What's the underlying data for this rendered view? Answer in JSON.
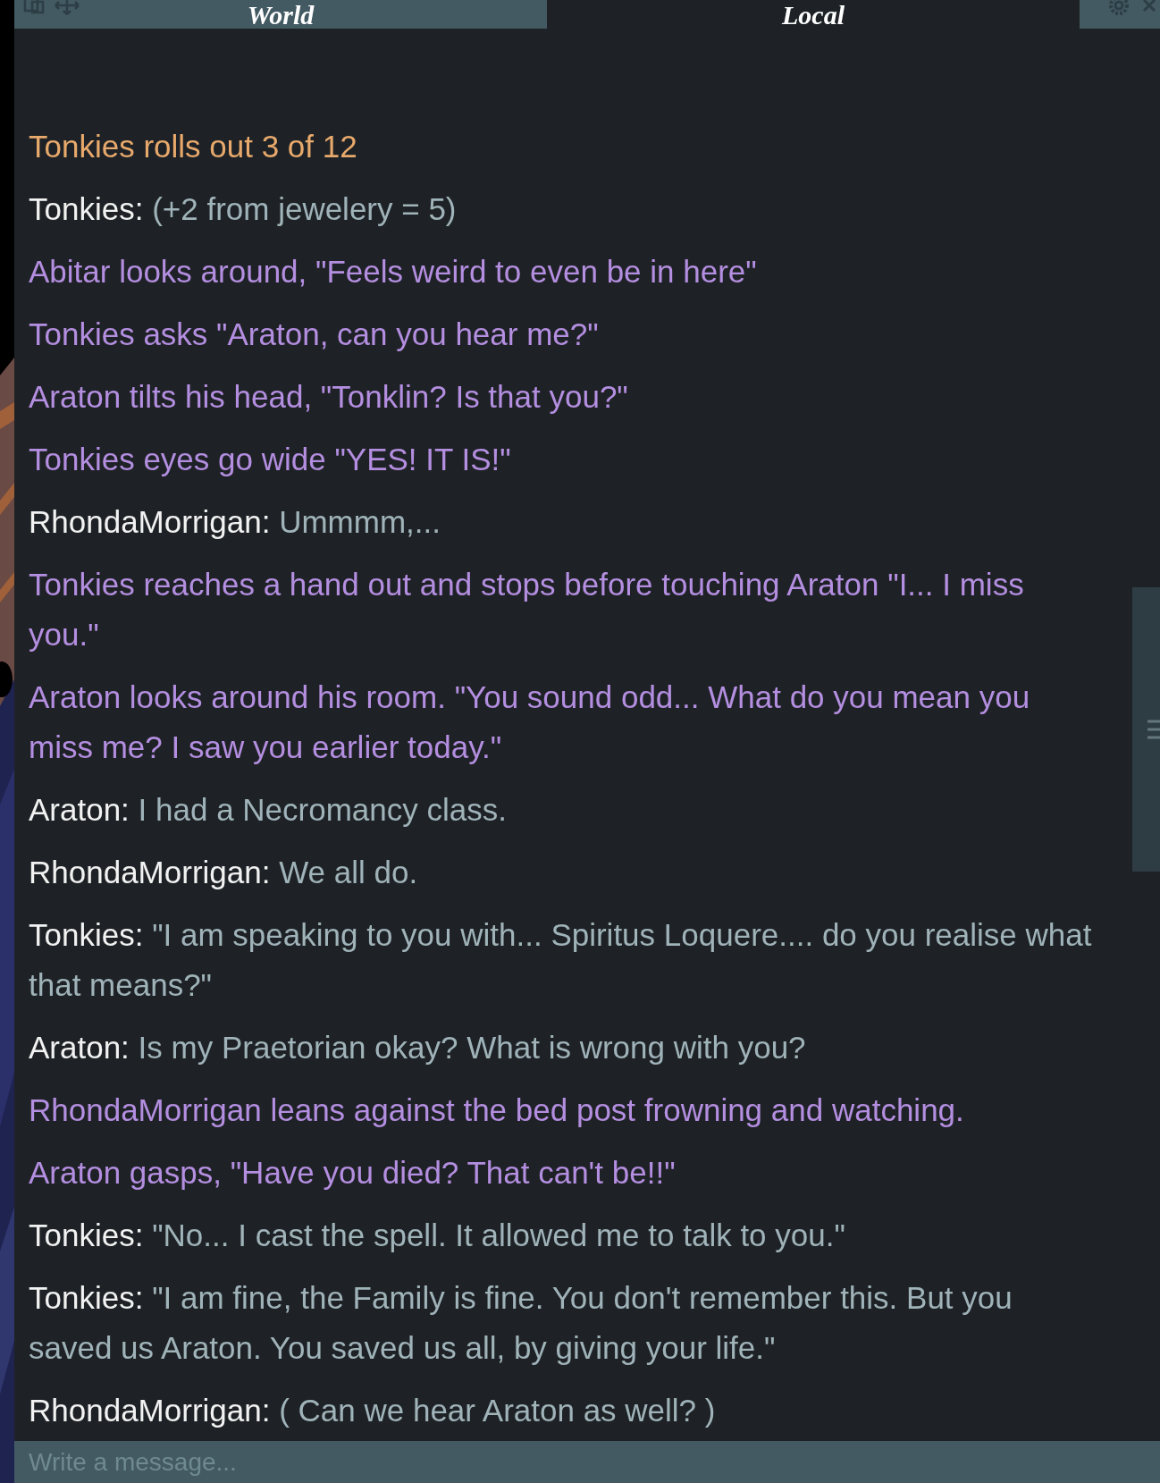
{
  "tabs": [
    {
      "label": "World",
      "selected": true
    },
    {
      "label": "Local",
      "selected": false
    }
  ],
  "messages": [
    {
      "kind": "roll",
      "text": "Tonkies rolls out 3 of 12"
    },
    {
      "kind": "say",
      "name": "Tonkies:",
      "text": "(+2 from jewelery = 5)"
    },
    {
      "kind": "emote",
      "text": "Abitar looks around, \"Feels weird to even be in here\""
    },
    {
      "kind": "emote",
      "text": "Tonkies asks \"Araton, can you hear me?\""
    },
    {
      "kind": "emote",
      "text": "Araton tilts his head, \"Tonklin? Is that you?\""
    },
    {
      "kind": "emote",
      "text": "Tonkies eyes go wide \"YES! IT IS!\""
    },
    {
      "kind": "say",
      "name": "RhondaMorrigan:",
      "text": "Ummmm,..."
    },
    {
      "kind": "emote",
      "text": "Tonkies reaches a hand out and stops before touching Araton \"I... I miss you.\""
    },
    {
      "kind": "emote",
      "text": "Araton looks around his room. \"You sound odd... What do you mean you miss me? I saw you earlier today.\""
    },
    {
      "kind": "say",
      "name": "Araton:",
      "text": "I had a Necromancy class."
    },
    {
      "kind": "say",
      "name": "RhondaMorrigan:",
      "text": "We all do."
    },
    {
      "kind": "say",
      "name": "Tonkies:",
      "text": "\"I am speaking to you with... Spiritus Loquere.... do you realise what that means?\""
    },
    {
      "kind": "say",
      "name": "Araton:",
      "text": "Is my Praetorian okay? What is wrong with you?"
    },
    {
      "kind": "emote",
      "text": "RhondaMorrigan leans against the bed post frowning and watching."
    },
    {
      "kind": "emote",
      "text": "Araton gasps, \"Have you died? That can't be!!\""
    },
    {
      "kind": "say",
      "name": "Tonkies:",
      "text": "\"No... I cast the spell. It allowed me to talk to you.\""
    },
    {
      "kind": "say",
      "name": "Tonkies:",
      "text": "\"I am fine, the Family is fine. You don't remember this. But you saved us Araton. You saved us all, by giving your life.\""
    },
    {
      "kind": "say",
      "name": "RhondaMorrigan:",
      "text": "( Can we hear Araton as well? )"
    }
  ],
  "input": {
    "placeholder": "Write a message..."
  }
}
